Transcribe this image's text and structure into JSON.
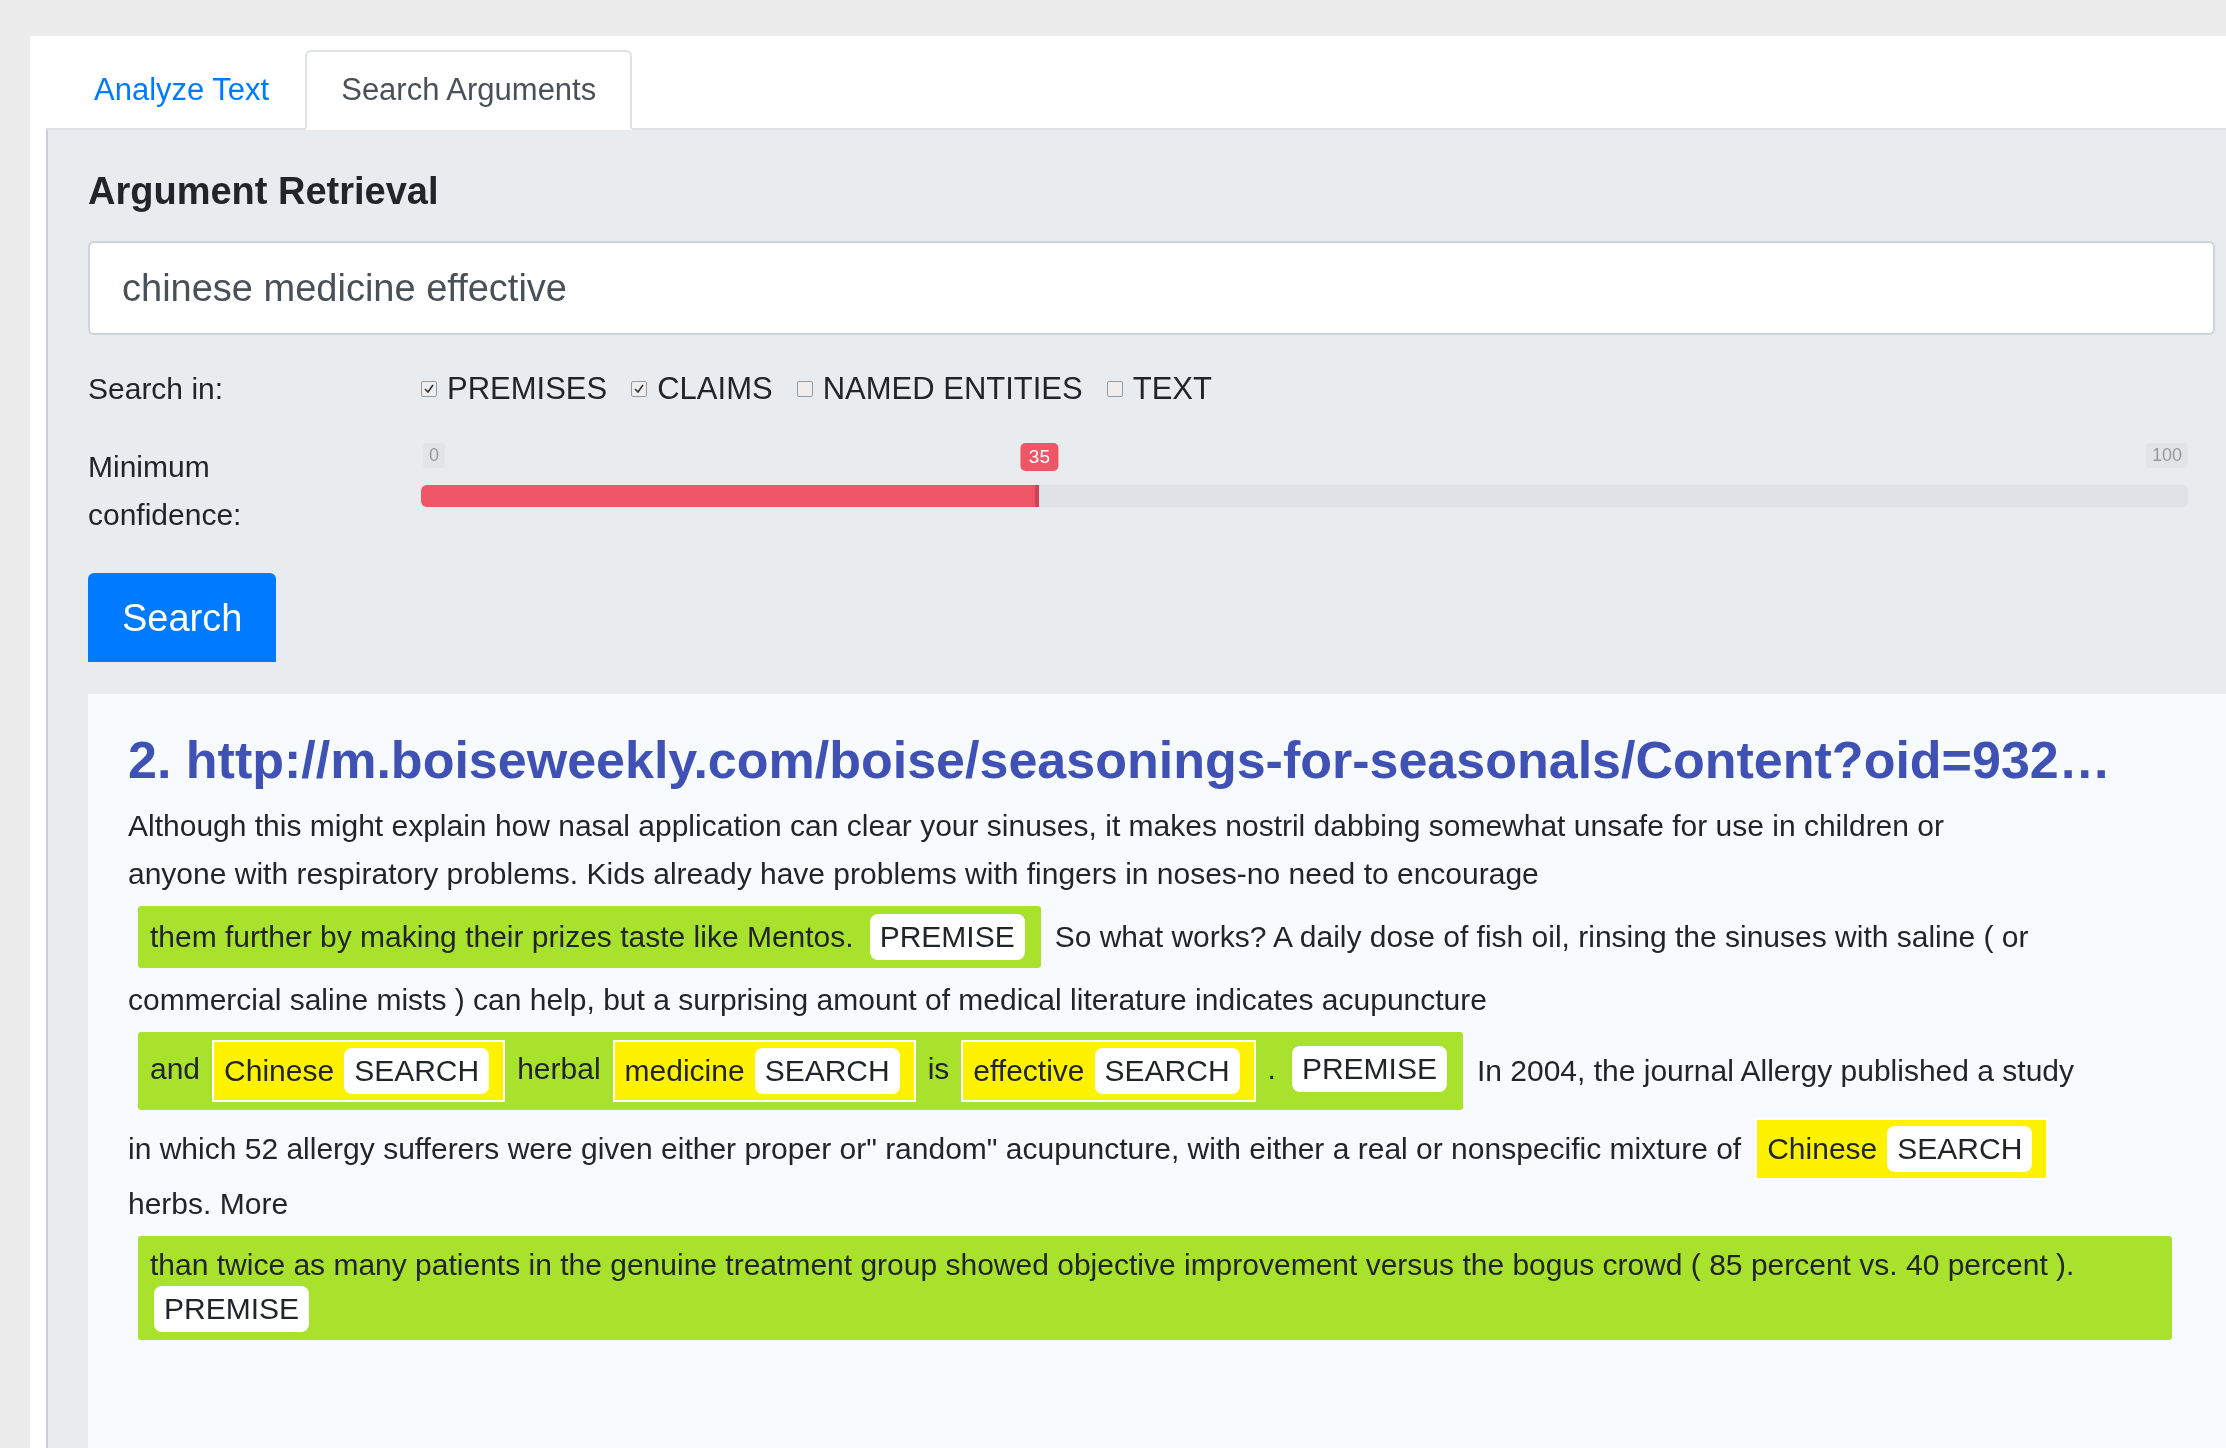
{
  "tabs": [
    {
      "label": "Analyze Text",
      "selected": false
    },
    {
      "label": "Search Arguments",
      "selected": true
    }
  ],
  "form": {
    "title": "Argument Retrieval",
    "query": "chinese medicine effective",
    "search_in_label": "Search in:",
    "options": [
      {
        "label": "PREMISES",
        "checked": true
      },
      {
        "label": "CLAIMS",
        "checked": true
      },
      {
        "label": "NAMED ENTITIES",
        "checked": false
      },
      {
        "label": "TEXT",
        "checked": false
      }
    ],
    "confidence": {
      "label": "Minimum confidence:",
      "min": "0",
      "max": "100",
      "value": "35",
      "level": 0.35
    },
    "button": "Search"
  },
  "results": [
    {
      "title": "2. http://m.boiseweekly.com/boise/seasonings-for-seasonals/Content?oid=932…",
      "lines": [
        [
          {
            "kind": "text",
            "text": "Although this might explain how nasal application can clear your sinuses, it makes nostril dabbing somewhat unsafe for use in children or"
          }
        ],
        [
          {
            "kind": "text",
            "text": "anyone with respiratory problems. Kids already have problems with fingers in noses-no need to encourage"
          }
        ],
        [
          {
            "kind": "premise",
            "label": "PREMISE",
            "parts": [
              {
                "kind": "text",
                "text": "them further by making their prizes taste like Mentos."
              }
            ]
          },
          {
            "kind": "text",
            "text": "So what works? A daily dose of fish oil, rinsing the sinuses with saline ( or"
          }
        ],
        [
          {
            "kind": "text",
            "text": "commercial saline mists ) can help, but a surprising amount of medical literature indicates acupuncture"
          }
        ],
        [
          {
            "kind": "premise",
            "label": "PREMISE",
            "parts": [
              {
                "kind": "text",
                "text": "and"
              },
              {
                "kind": "term",
                "text": "Chinese",
                "label": "SEARCH"
              },
              {
                "kind": "text",
                "text": "herbal"
              },
              {
                "kind": "term",
                "text": "medicine",
                "label": "SEARCH"
              },
              {
                "kind": "text",
                "text": "is"
              },
              {
                "kind": "term",
                "text": "effective",
                "label": "SEARCH"
              },
              {
                "kind": "text",
                "text": "."
              }
            ]
          },
          {
            "kind": "text",
            "text": "In 2004, the journal Allergy published a study"
          }
        ],
        [
          {
            "kind": "text",
            "text": "in which 52 allergy sufferers were given either proper or\" random\" acupuncture, with either a real or nonspecific mixture of"
          },
          {
            "kind": "term",
            "text": "Chinese",
            "label": "SEARCH"
          }
        ],
        [
          {
            "kind": "text",
            "text": "herbs. More"
          }
        ],
        [
          {
            "kind": "premise",
            "label": "PREMISE",
            "parts": [
              {
                "kind": "text",
                "text": "than twice as many patients in the genuine treatment group showed objective improvement versus the bogus crowd ( 85 percent vs. 40 percent )."
              }
            ]
          }
        ]
      ]
    }
  ]
}
